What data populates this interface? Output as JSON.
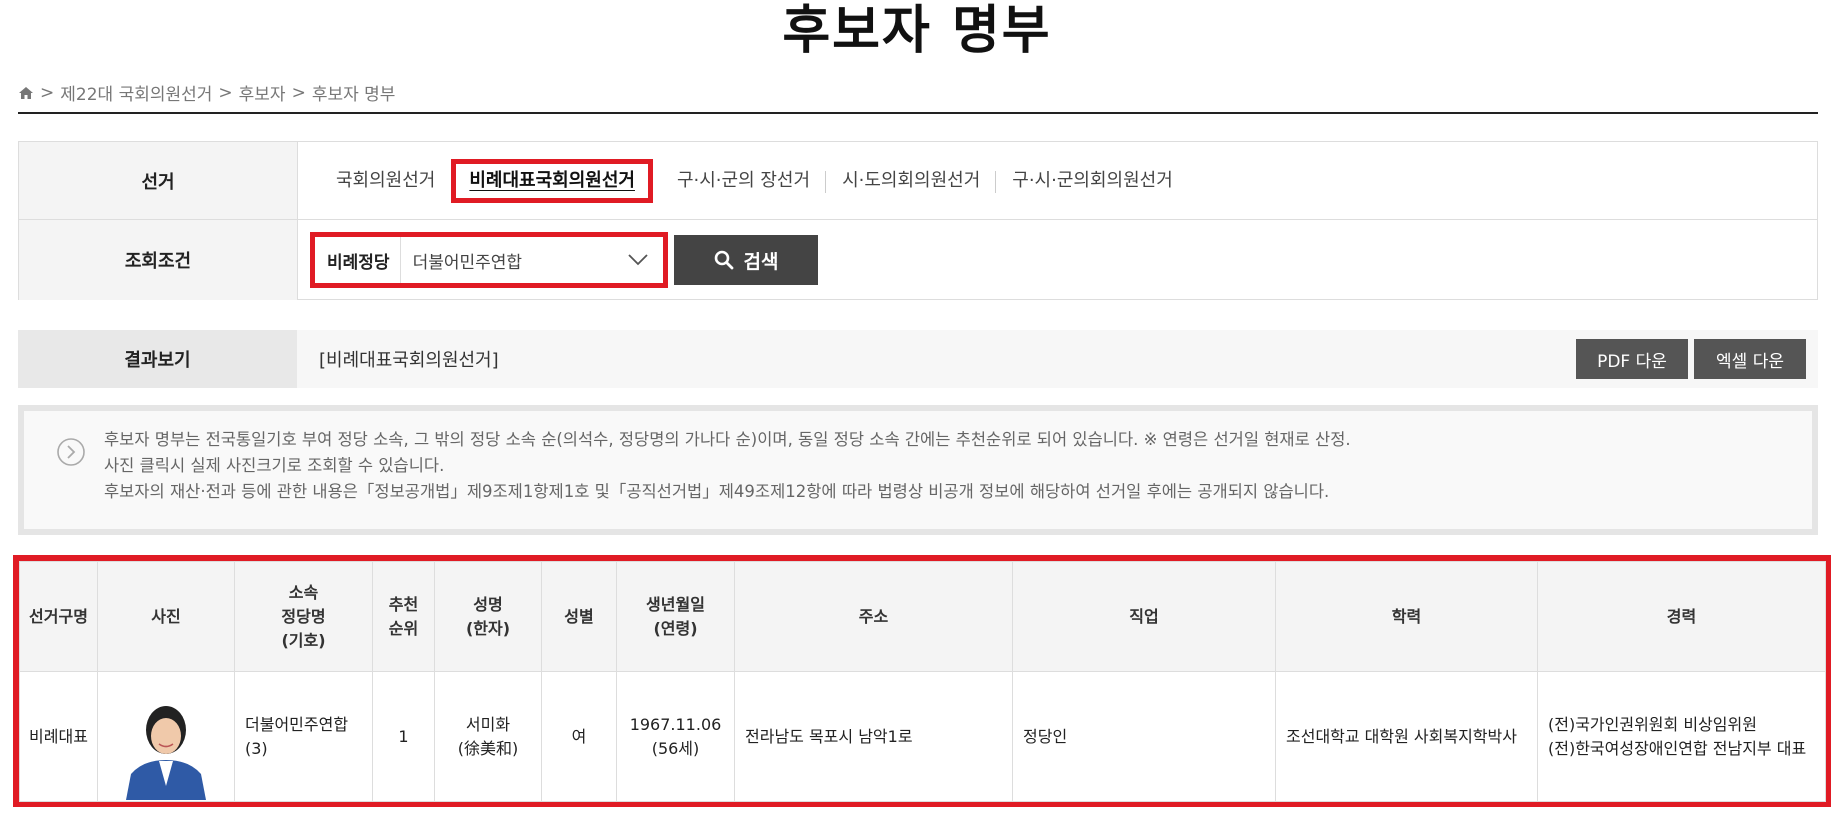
{
  "title": "후보자 명부",
  "breadcrumb": {
    "sep": ">",
    "items": [
      "제22대 국회의원선거",
      "후보자",
      "후보자 명부"
    ]
  },
  "filter": {
    "election_label": "선거",
    "tabs": [
      "국회의원선거",
      "비례대표국회의원선거",
      "구·시·군의 장선거",
      "시·도의회의원선거",
      "구·시·군의회의원선거"
    ],
    "condition_label": "조회조건",
    "party_label": "비례정당",
    "party_value": "더불어민주연합",
    "search_label": "검색"
  },
  "result": {
    "label": "결과보기",
    "value": "[비례대표국회의원선거]",
    "pdf_label": "PDF 다운",
    "excel_label": "엑셀 다운"
  },
  "notice": [
    "후보자 명부는 전국통일기호 부여 정당 소속, 그 밖의 정당 소속 순(의석수, 정당명의 가나다 순)이며, 동일 정당 소속 간에는 추천순위로 되어 있습니다. ※ 연령은 선거일 현재로 산정.",
    "사진 클릭시 실제 사진크기로 조회할 수 있습니다.",
    "후보자의 재산·전과 등에 관한 내용은「정보공개법」제9조제1항제1호 및「공직선거법」제49조제12항에 따라 법령상 비공개 정보에 해당하여 선거일 후에는 공개되지 않습니다."
  ],
  "table": {
    "headers": {
      "election": "선거구명",
      "photo": "사진",
      "party_1": "소속",
      "party_2": "정당명",
      "party_3": "(기호)",
      "rank_1": "추천",
      "rank_2": "순위",
      "name_1": "성명",
      "name_2": "(한자)",
      "gender": "성별",
      "birth_1": "생년월일",
      "birth_2": "(연령)",
      "address": "주소",
      "job": "직업",
      "education": "학력",
      "career": "경력"
    },
    "row": {
      "election": "비례대표",
      "party": "더불어민주연합",
      "party_no": "(3)",
      "rank": "1",
      "name": "서미화",
      "hanja": "(徐美和)",
      "gender": "여",
      "birth": "1967.11.06",
      "age": "(56세)",
      "address": "전라남도 목포시 남악1로",
      "job": "정당인",
      "education": "조선대학교 대학원 사회복지학박사",
      "career_1": "(전)국가인권위원회 비상임위원",
      "career_2": "(전)한국여성장애인연합 전남지부 대표"
    }
  },
  "colors": {
    "highlight": "#e01b24",
    "button": "#444444"
  }
}
